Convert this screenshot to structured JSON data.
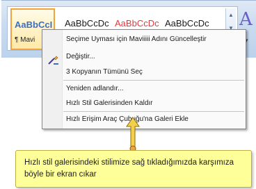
{
  "gallery": {
    "tiles": [
      {
        "sample": "AaBbCcI",
        "caption": "¶ Mavi",
        "color": "#3b6fc2",
        "selected": true
      },
      {
        "sample": "AaBbCcDc",
        "caption": "",
        "color": "#1a1a1a",
        "selected": false
      },
      {
        "sample": "AaBbCcDc",
        "caption": "",
        "color": "#e23a3a",
        "selected": false
      },
      {
        "sample": "AaBbCcDc",
        "caption": "",
        "color": "#1a1a1a",
        "selected": false
      }
    ],
    "more_icon": "styles-big-icon"
  },
  "context_menu": {
    "items": [
      {
        "label": "Seçime Uyması için Maviiiii Adını Güncelleştir",
        "icon": ""
      },
      {
        "label": "Değiştir...",
        "icon": "modify-style-icon"
      },
      {
        "label": "3 Kopyanın Tümünü Seç",
        "icon": ""
      },
      {
        "label": "Yeniden adlandır...",
        "icon": ""
      },
      {
        "label": "Hızlı Stil Galerisinden Kaldır",
        "icon": ""
      },
      {
        "label": "Hızlı Erişim Araç Çubuğu'na Galeri Ekle",
        "icon": ""
      }
    ]
  },
  "callout": {
    "text": "Hızlı stil galerisindeki stilimize sağ tıkladığımızda karşımıza böyle bir ekran cıkar",
    "color": "#ffff99"
  }
}
